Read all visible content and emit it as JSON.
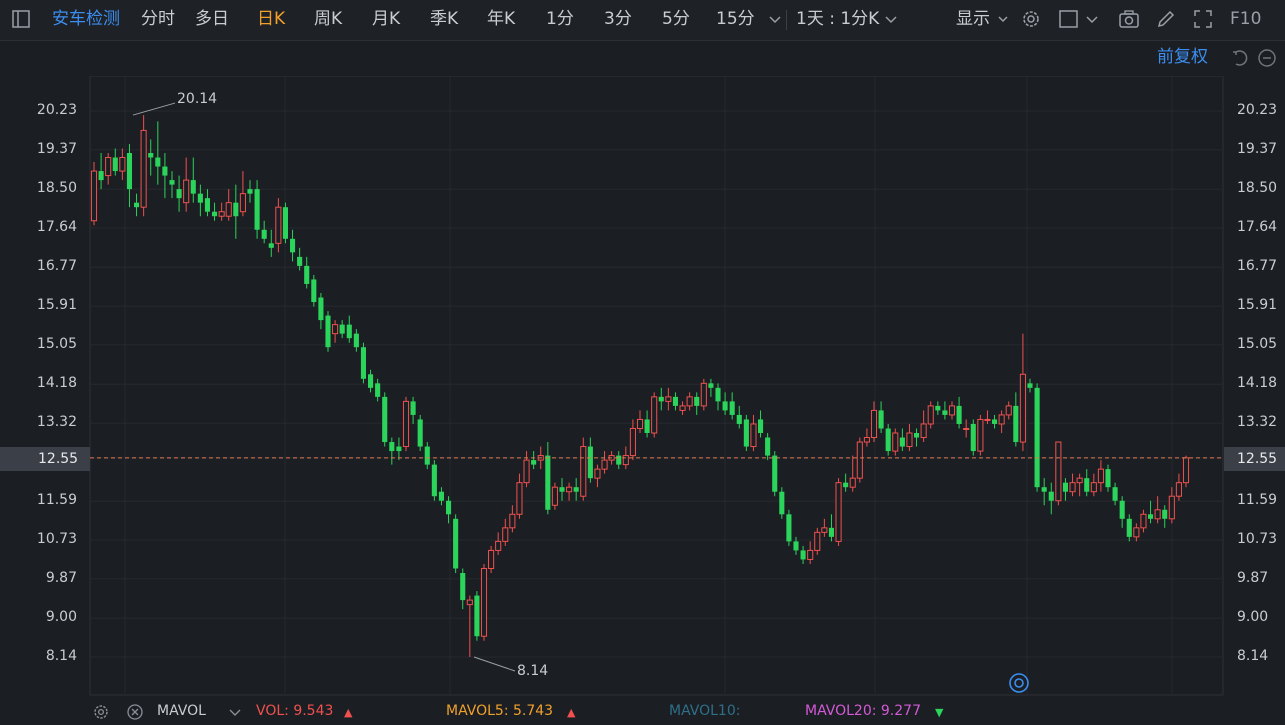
{
  "toolbar": {
    "sidebar_toggle_icon": "sidebar-toggle-icon",
    "stock_name": "安车检测",
    "tabs": [
      "分时",
      "多日",
      "日K",
      "周K",
      "月K",
      "季K",
      "年K",
      "1分",
      "3分",
      "5分",
      "15分"
    ],
    "active_tab": "日K",
    "more_periods_icon": "chevron-down-icon",
    "period_combo": "1天 : 1分K",
    "display_label": "显示",
    "f10_label": "F10"
  },
  "subbar": {
    "adjust_label": "前复权"
  },
  "colors": {
    "up": "#f0514f",
    "down": "#2bd45b",
    "accent": "#3b8ef0",
    "active": "#f0a12c",
    "current_price_line": "#e07b52"
  },
  "chart_data": {
    "type": "candlestick",
    "y_ticks": [
      "20.23",
      "19.37",
      "18.50",
      "17.64",
      "16.77",
      "15.91",
      "15.05",
      "14.18",
      "13.32",
      "12.55",
      "11.59",
      "10.73",
      "9.87",
      "9.00",
      "8.14"
    ],
    "ylim": [
      8.14,
      20.23
    ],
    "current_price": "12.55",
    "high_annotation": "20.14",
    "low_annotation": "8.14",
    "candles": [
      [
        17.8,
        18.9,
        19.1,
        17.7
      ],
      [
        18.9,
        18.7,
        19.3,
        18.5
      ],
      [
        18.8,
        19.2,
        19.3,
        18.6
      ],
      [
        19.2,
        18.9,
        19.4,
        18.8
      ],
      [
        18.9,
        19.2,
        19.4,
        18.7
      ],
      [
        19.3,
        18.5,
        19.5,
        18.1
      ],
      [
        18.2,
        18.1,
        18.4,
        17.9
      ],
      [
        18.1,
        19.8,
        20.14,
        17.9
      ],
      [
        19.3,
        19.2,
        19.6,
        18.8
      ],
      [
        19.2,
        19.0,
        20.0,
        18.6
      ],
      [
        19.0,
        18.8,
        19.3,
        18.3
      ],
      [
        18.7,
        18.6,
        18.9,
        18.3
      ],
      [
        18.5,
        18.3,
        18.8,
        18.0
      ],
      [
        18.2,
        18.7,
        19.2,
        18.0
      ],
      [
        18.7,
        18.4,
        19.2,
        18.2
      ],
      [
        18.4,
        18.2,
        18.6,
        17.9
      ],
      [
        18.3,
        18.0,
        18.5,
        17.9
      ],
      [
        18.0,
        17.9,
        18.2,
        17.8
      ],
      [
        17.9,
        18.0,
        18.2,
        17.8
      ],
      [
        17.9,
        18.2,
        18.5,
        17.8
      ],
      [
        18.2,
        17.9,
        18.6,
        17.4
      ],
      [
        18.0,
        18.4,
        18.9,
        17.9
      ],
      [
        18.5,
        18.4,
        18.7,
        18.2
      ],
      [
        18.5,
        17.6,
        18.7,
        17.4
      ],
      [
        17.6,
        17.4,
        17.8,
        17.3
      ],
      [
        17.3,
        17.2,
        17.6,
        17.0
      ],
      [
        17.3,
        18.1,
        18.3,
        17.1
      ],
      [
        18.1,
        17.4,
        18.2,
        17.3
      ],
      [
        17.4,
        17.1,
        17.6,
        16.9
      ],
      [
        17.0,
        16.8,
        17.2,
        16.7
      ],
      [
        16.8,
        16.4,
        17.0,
        16.3
      ],
      [
        16.5,
        16.0,
        16.6,
        15.9
      ],
      [
        16.1,
        15.6,
        16.2,
        15.4
      ],
      [
        15.7,
        15.0,
        15.8,
        14.9
      ],
      [
        15.3,
        15.5,
        15.6,
        15.1
      ],
      [
        15.5,
        15.3,
        15.6,
        15.2
      ],
      [
        15.5,
        15.2,
        15.7,
        15.1
      ],
      [
        15.3,
        15.0,
        15.4,
        14.9
      ],
      [
        15.0,
        14.3,
        15.1,
        14.2
      ],
      [
        14.4,
        14.1,
        14.5,
        14.0
      ],
      [
        14.2,
        13.9,
        14.3,
        13.8
      ],
      [
        13.9,
        12.9,
        14.0,
        12.8
      ],
      [
        12.9,
        12.7,
        13.0,
        12.4
      ],
      [
        12.8,
        12.7,
        13.0,
        12.5
      ],
      [
        12.8,
        13.8,
        13.9,
        12.7
      ],
      [
        13.8,
        13.5,
        13.9,
        13.3
      ],
      [
        13.4,
        12.8,
        13.5,
        12.7
      ],
      [
        12.8,
        12.4,
        12.9,
        12.3
      ],
      [
        12.4,
        11.7,
        12.5,
        11.6
      ],
      [
        11.8,
        11.6,
        11.9,
        11.5
      ],
      [
        11.6,
        11.3,
        11.7,
        11.1
      ],
      [
        11.2,
        10.1,
        11.3,
        10.0
      ],
      [
        10.0,
        9.4,
        10.1,
        9.2
      ],
      [
        9.3,
        9.4,
        9.5,
        8.14
      ],
      [
        9.5,
        8.6,
        9.6,
        8.5
      ],
      [
        8.6,
        10.1,
        10.2,
        8.5
      ],
      [
        10.1,
        10.5,
        10.6,
        10.0
      ],
      [
        10.5,
        10.7,
        10.9,
        10.4
      ],
      [
        10.7,
        11.0,
        11.2,
        10.6
      ],
      [
        11.0,
        11.3,
        11.5,
        10.9
      ],
      [
        11.3,
        12.0,
        12.2,
        11.2
      ],
      [
        12.0,
        12.5,
        12.7,
        11.9
      ],
      [
        12.5,
        12.4,
        12.7,
        12.3
      ],
      [
        12.5,
        12.6,
        12.8,
        12.3
      ],
      [
        12.6,
        11.4,
        12.9,
        11.3
      ],
      [
        11.5,
        11.9,
        12.0,
        11.4
      ],
      [
        11.9,
        11.8,
        12.1,
        11.6
      ],
      [
        11.8,
        11.9,
        12.0,
        11.6
      ],
      [
        11.9,
        11.8,
        12.1,
        11.6
      ],
      [
        11.7,
        12.8,
        13.0,
        11.6
      ],
      [
        12.8,
        12.1,
        13.0,
        12.0
      ],
      [
        12.1,
        12.3,
        12.4,
        11.9
      ],
      [
        12.3,
        12.5,
        12.7,
        12.2
      ],
      [
        12.5,
        12.6,
        12.7,
        12.4
      ],
      [
        12.6,
        12.4,
        12.7,
        12.3
      ],
      [
        12.4,
        12.6,
        12.8,
        12.3
      ],
      [
        12.6,
        13.2,
        13.4,
        12.5
      ],
      [
        13.2,
        13.4,
        13.6,
        13.1
      ],
      [
        13.4,
        13.1,
        13.6,
        13.0
      ],
      [
        13.1,
        13.9,
        14.0,
        13.0
      ],
      [
        13.9,
        13.8,
        14.1,
        13.6
      ],
      [
        13.8,
        13.9,
        14.1,
        13.6
      ],
      [
        13.9,
        13.7,
        14.0,
        13.6
      ],
      [
        13.6,
        13.7,
        13.8,
        13.5
      ],
      [
        13.7,
        13.9,
        14.0,
        13.6
      ],
      [
        13.9,
        13.7,
        14.0,
        13.5
      ],
      [
        13.7,
        14.2,
        14.3,
        13.6
      ],
      [
        14.2,
        14.1,
        14.3,
        13.9
      ],
      [
        14.1,
        13.8,
        14.2,
        13.6
      ],
      [
        13.8,
        13.6,
        14.0,
        13.5
      ],
      [
        13.8,
        13.5,
        14.0,
        13.4
      ],
      [
        13.5,
        13.3,
        13.7,
        13.2
      ],
      [
        13.4,
        12.8,
        13.5,
        12.7
      ],
      [
        12.8,
        13.3,
        13.5,
        12.7
      ],
      [
        13.4,
        13.1,
        13.6,
        13.0
      ],
      [
        13.0,
        12.6,
        13.1,
        12.5
      ],
      [
        12.6,
        11.8,
        12.7,
        11.7
      ],
      [
        11.8,
        11.3,
        11.9,
        11.2
      ],
      [
        11.3,
        10.7,
        11.4,
        10.6
      ],
      [
        10.7,
        10.5,
        10.8,
        10.4
      ],
      [
        10.5,
        10.3,
        10.6,
        10.2
      ],
      [
        10.3,
        10.5,
        10.7,
        10.2
      ],
      [
        10.5,
        10.9,
        11.0,
        10.4
      ],
      [
        10.9,
        11.0,
        11.2,
        10.8
      ],
      [
        11.0,
        10.8,
        11.3,
        10.7
      ],
      [
        10.7,
        12.0,
        12.1,
        10.6
      ],
      [
        12.0,
        11.9,
        12.2,
        11.8
      ],
      [
        11.9,
        12.1,
        12.6,
        11.8
      ],
      [
        12.1,
        12.9,
        13.0,
        12.0
      ],
      [
        12.9,
        13.0,
        13.2,
        12.8
      ],
      [
        13.0,
        13.6,
        13.8,
        12.9
      ],
      [
        13.6,
        13.2,
        13.8,
        13.1
      ],
      [
        13.2,
        12.7,
        13.3,
        12.6
      ],
      [
        12.7,
        13.1,
        13.2,
        12.6
      ],
      [
        13.0,
        12.8,
        13.2,
        12.7
      ],
      [
        12.8,
        13.1,
        13.3,
        12.7
      ],
      [
        13.1,
        13.0,
        13.2,
        12.8
      ],
      [
        13.0,
        13.3,
        13.6,
        12.9
      ],
      [
        13.3,
        13.7,
        13.8,
        13.2
      ],
      [
        13.7,
        13.6,
        13.8,
        13.5
      ],
      [
        13.6,
        13.5,
        13.8,
        13.4
      ],
      [
        13.5,
        13.7,
        13.8,
        13.4
      ],
      [
        13.7,
        13.3,
        13.9,
        13.2
      ],
      [
        13.2,
        13.2,
        13.4,
        13.0
      ],
      [
        13.3,
        12.7,
        13.4,
        12.6
      ],
      [
        12.7,
        13.4,
        13.5,
        12.6
      ],
      [
        13.4,
        13.4,
        13.6,
        13.3
      ],
      [
        13.4,
        13.3,
        13.5,
        13.2
      ],
      [
        13.3,
        13.5,
        13.6,
        13.1
      ],
      [
        13.5,
        13.7,
        13.8,
        13.4
      ],
      [
        13.7,
        12.9,
        14.0,
        12.8
      ],
      [
        12.9,
        14.4,
        15.3,
        12.7
      ],
      [
        14.2,
        14.1,
        14.3,
        14.0
      ],
      [
        14.1,
        11.9,
        14.2,
        11.8
      ],
      [
        11.9,
        11.8,
        12.1,
        11.5
      ],
      [
        11.8,
        11.6,
        12.0,
        11.3
      ],
      [
        11.6,
        12.9,
        12.9,
        11.5
      ],
      [
        12.0,
        11.8,
        12.1,
        11.6
      ],
      [
        11.8,
        12.0,
        12.2,
        11.7
      ],
      [
        12.0,
        12.1,
        12.2,
        11.7
      ],
      [
        12.1,
        11.8,
        12.3,
        11.7
      ],
      [
        11.8,
        12.0,
        12.2,
        11.7
      ],
      [
        12.0,
        12.3,
        12.5,
        11.8
      ],
      [
        12.3,
        11.9,
        12.4,
        11.8
      ],
      [
        11.9,
        11.6,
        12.0,
        11.5
      ],
      [
        11.6,
        11.2,
        11.7,
        11.0
      ],
      [
        11.2,
        10.8,
        11.3,
        10.7
      ],
      [
        10.8,
        11.0,
        11.1,
        10.7
      ],
      [
        11.0,
        11.3,
        11.4,
        10.9
      ],
      [
        11.3,
        11.2,
        11.6,
        11.1
      ],
      [
        11.2,
        11.4,
        11.7,
        11.1
      ],
      [
        11.4,
        11.2,
        11.5,
        11.0
      ],
      [
        11.2,
        11.7,
        11.9,
        11.1
      ],
      [
        11.7,
        12.0,
        12.2,
        11.6
      ],
      [
        12.0,
        12.55,
        12.6,
        11.9
      ]
    ],
    "volume_indicator": {
      "name": "MAVOL",
      "vol_label": "VOL: 9.543",
      "mavol5_label": "MAVOL5: 5.743",
      "mavol10_label": "MAVOL10:",
      "mavol20_label": "MAVOL20: 9.277"
    }
  }
}
